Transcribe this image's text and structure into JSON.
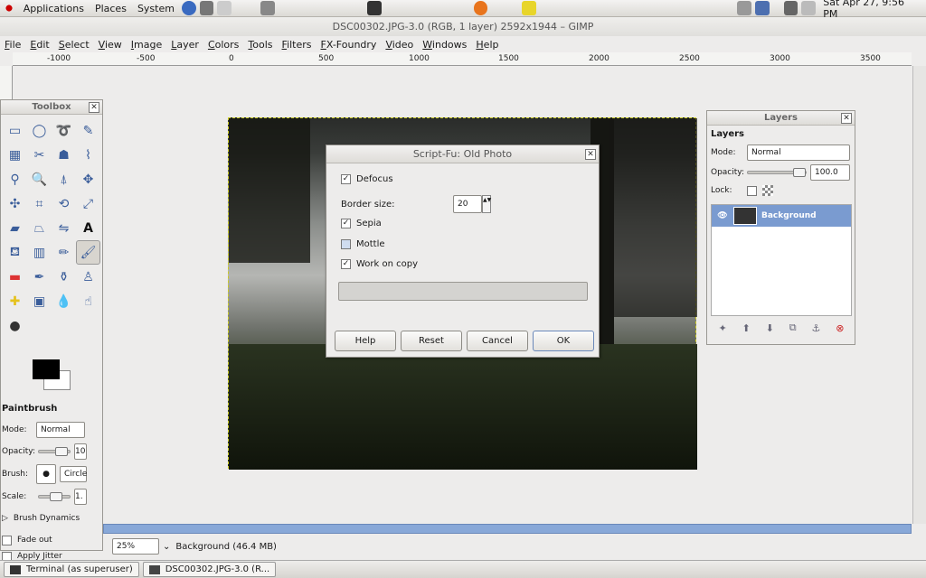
{
  "top_panel": {
    "menus": [
      "Applications",
      "Places",
      "System"
    ],
    "clock": "Sat Apr 27,  9:56 PM"
  },
  "window": {
    "title": "DSC00302.JPG-3.0 (RGB, 1 layer) 2592x1944 – GIMP"
  },
  "menubar": [
    "File",
    "Edit",
    "Select",
    "View",
    "Image",
    "Layer",
    "Colors",
    "Tools",
    "Filters",
    "FX-Foundry",
    "Video",
    "Windows",
    "Help"
  ],
  "ruler": [
    "-1000",
    "-500",
    "0",
    "500",
    "1000",
    "1500",
    "2000",
    "2500",
    "3000",
    "3500"
  ],
  "toolbox": {
    "title": "Toolbox",
    "tool_options_title": "Paintbrush",
    "mode_label": "Mode:",
    "mode_value": "Normal",
    "opacity_label": "Opacity:",
    "opacity_value": "10",
    "brush_label": "Brush:",
    "brush_value": "Circle",
    "scale_label": "Scale:",
    "scale_value": "1.",
    "brush_dynamics": "Brush Dynamics",
    "fade_out": "Fade out",
    "apply_jitter": "Apply Jitter"
  },
  "layers": {
    "title": "Layers",
    "header": "Layers",
    "mode_label": "Mode:",
    "mode_value": "Normal",
    "opacity_label": "Opacity:",
    "opacity_value": "100.0",
    "lock_label": "Lock:",
    "layer_name": "Background"
  },
  "dialog": {
    "title": "Script-Fu: Old Photo",
    "defocus": "Defocus",
    "border_label": "Border size:",
    "border_value": "20",
    "sepia": "Sepia",
    "mottle": "Mottle",
    "work_on_copy": "Work on copy",
    "buttons": {
      "help": "Help",
      "reset": "Reset",
      "cancel": "Cancel",
      "ok": "OK"
    }
  },
  "status": {
    "zoom": "25%",
    "info": "Background (46.4 MB)"
  },
  "taskbar": [
    "Terminal (as superuser)",
    "DSC00302.JPG-3.0 (R..."
  ]
}
